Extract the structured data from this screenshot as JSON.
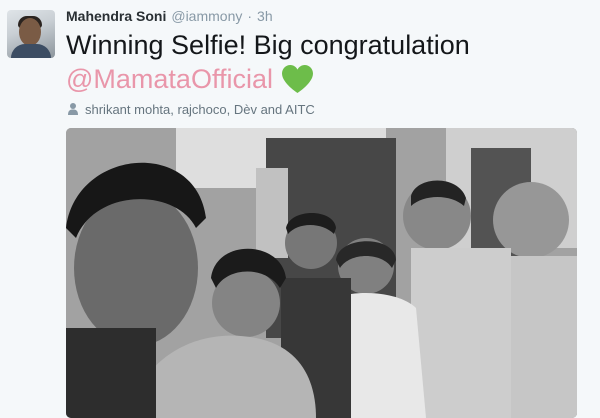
{
  "tweet": {
    "author_name": "Mahendra Soni",
    "author_handle": "@iammony",
    "separator": "·",
    "timestamp": "3h",
    "text": "Winning Selfie! Big congratulation",
    "mention": "@MamataOfficial",
    "emoji": "green-heart-icon",
    "tagged_people": "shrikant mohta, rajchoco, Dèv and AITC",
    "photo": "selfie-photo"
  },
  "colors": {
    "mention": "#e996aa",
    "heart": "#6dbd4a",
    "handle": "#8899a6",
    "name": "#292f33"
  }
}
